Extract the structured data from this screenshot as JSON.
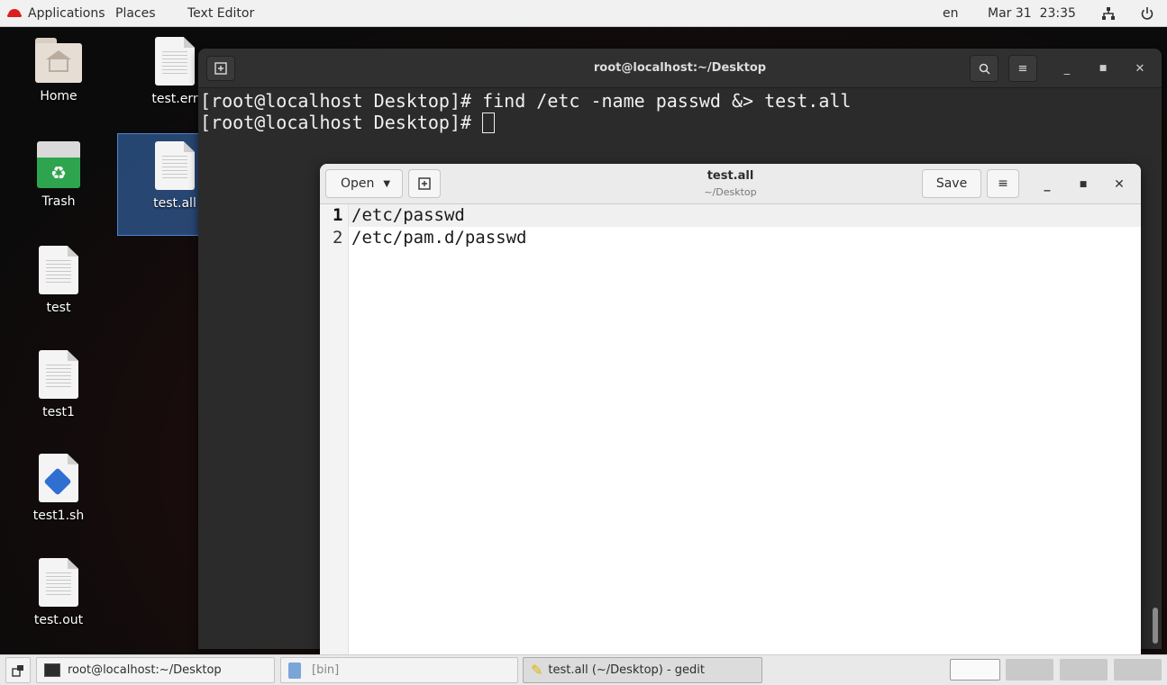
{
  "topbar": {
    "applications": "Applications",
    "places": "Places",
    "active_app": "Text Editor",
    "lang": "en",
    "clock": "Mar 31  23:35"
  },
  "desktop": {
    "icons": [
      {
        "label": "Home",
        "type": "folder"
      },
      {
        "label": "test.err",
        "type": "document"
      },
      {
        "label": "Trash",
        "type": "trash"
      },
      {
        "label": "test.all",
        "type": "document"
      },
      {
        "label": "test",
        "type": "document"
      },
      {
        "label": "test1",
        "type": "document"
      },
      {
        "label": "test1.sh",
        "type": "script"
      },
      {
        "label": "test.out",
        "type": "document"
      }
    ]
  },
  "terminal": {
    "title": "root@localhost:~/Desktop",
    "lines": [
      "[root@localhost Desktop]# find /etc -name passwd &> test.all",
      "[root@localhost Desktop]# "
    ]
  },
  "gedit": {
    "open_label": "Open",
    "title": "test.all",
    "subtitle": "~/Desktop",
    "save_label": "Save",
    "line_numbers": [
      "1",
      "2"
    ],
    "lines": [
      "/etc/passwd",
      "/etc/pam.d/passwd"
    ]
  },
  "taskbar": {
    "tasks": [
      {
        "label": "root@localhost:~/Desktop",
        "icon": "terminal-icon"
      },
      {
        "label": "[bin]",
        "icon": "file-manager-icon"
      },
      {
        "label": "test.all (~/Desktop) - gedit",
        "icon": "text-editor-icon"
      }
    ],
    "workspaces": 4,
    "current_workspace": 1
  },
  "colors": {
    "accent_selection": "#4a86d4",
    "brand_red": "#d81e1e",
    "terminal_bg": "#2b2b2b"
  }
}
